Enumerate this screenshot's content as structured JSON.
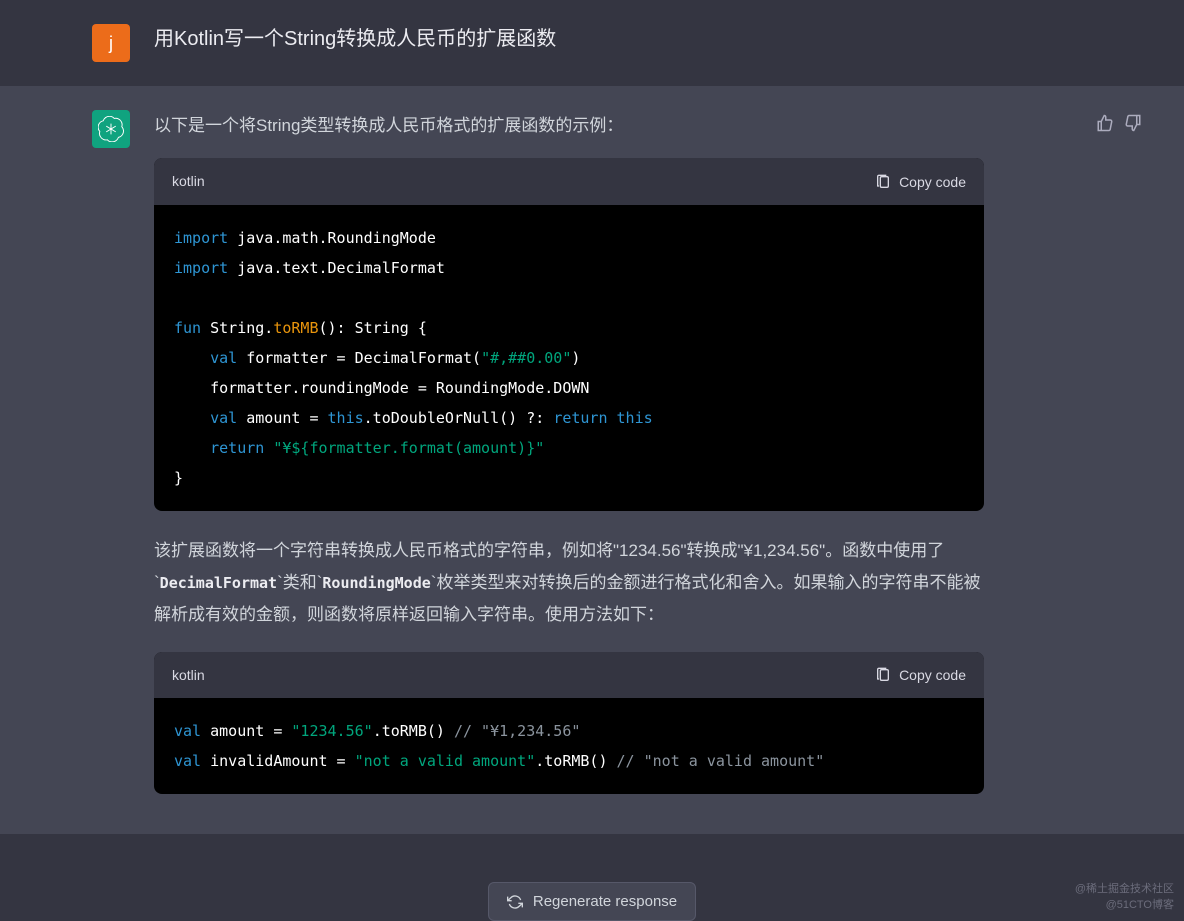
{
  "user": {
    "avatar_letter": "j",
    "message": "用Kotlin写一个String转换成人民币的扩展函数"
  },
  "assistant": {
    "intro": "以下是一个将String类型转换成人民币格式的扩展函数的示例：",
    "code1": {
      "lang": "kotlin",
      "copy_label": "Copy code",
      "tokens": {
        "import": "import",
        "import_line1_rest": " java.math.RoundingMode",
        "import_line2_rest": " java.text.DecimalFormat",
        "fun": "fun",
        "signature_prefix": " String.",
        "def_name": "toRMB",
        "signature_suffix": "(): String {",
        "val": "val",
        "formatter_assign": " formatter = DecimalFormat(",
        "format_pattern": "\"#,##0.00\"",
        "close_paren": ")",
        "rounding_line": "    formatter.roundingMode = RoundingMode.DOWN",
        "amount_prefix": " amount = ",
        "this": "this",
        "amount_mid": ".toDoubleOrNull() ?: ",
        "return": "return",
        "space_this": " ",
        "return_space": " ",
        "template_string": "\"¥${formatter.format(amount)}\"",
        "close_brace": "}"
      }
    },
    "description": {
      "part1": "该扩展函数将一个字符串转换成人民币格式的字符串，例如将\"1234.56\"转换成\"¥1,234.56\"。函数中使用了`",
      "code_a": "DecimalFormat",
      "part2": "`类和`",
      "code_b": "RoundingMode",
      "part3": "`枚举类型来对转换后的金额进行格式化和舍入。如果输入的字符串不能被解析成有效的金额，则函数将原样返回输入字符串。使用方法如下："
    },
    "code2": {
      "lang": "kotlin",
      "copy_label": "Copy code",
      "tokens": {
        "val": "val",
        "line1_name": " amount = ",
        "line1_str": "\"1234.56\"",
        "line1_call": ".toRMB() ",
        "line1_comment": "// \"¥1,234.56\"",
        "line2_name": " invalidAmount = ",
        "line2_str": "\"not a valid amount\"",
        "line2_call": ".toRMB() ",
        "line2_comment": "// \"not a valid amount\""
      }
    }
  },
  "regenerate_label": "Regenerate response",
  "watermark": {
    "line1": "@稀土掘金技术社区",
    "line2": "@51CTO博客"
  }
}
